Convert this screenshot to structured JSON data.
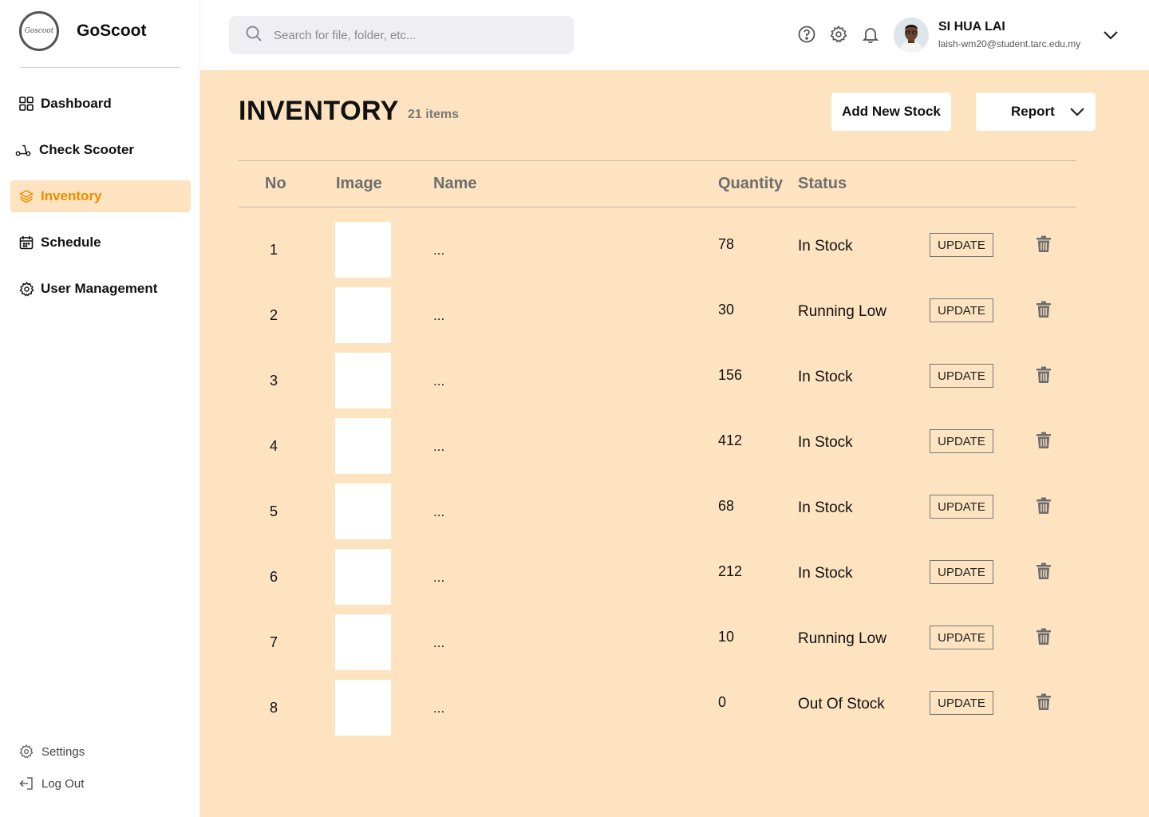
{
  "brand": {
    "logo_text": "Goscoot",
    "name": "GoScoot"
  },
  "nav": [
    {
      "label": "Dashboard",
      "icon": "grid-icon"
    },
    {
      "label": "Check Scooter",
      "icon": "scooter-icon"
    },
    {
      "label": "Inventory",
      "icon": "layers-icon",
      "active": true
    },
    {
      "label": "Schedule",
      "icon": "calendar-icon"
    },
    {
      "label": "User Management",
      "icon": "gear-icon"
    }
  ],
  "side_bottom": {
    "settings": "Settings",
    "logout": "Log Out"
  },
  "search": {
    "placeholder": "Search for file, folder, etc..."
  },
  "header_icons": [
    "help-icon",
    "gear-icon",
    "bell-icon"
  ],
  "user": {
    "name": "SI HUA LAI",
    "email": "laish-wm20@student.tarc.edu.my"
  },
  "page": {
    "title": "INVENTORY",
    "count": "21 items",
    "add_label": "Add New Stock",
    "report_label": "Report"
  },
  "table": {
    "headers": {
      "no": "No",
      "image": "Image",
      "name": "Name",
      "quantity": "Quantity",
      "status": "Status"
    },
    "update_label": "UPDATE",
    "rows": [
      {
        "no": "1",
        "name": "...",
        "quantity": "78",
        "status": "In Stock"
      },
      {
        "no": "2",
        "name": "...",
        "quantity": "30",
        "status": "Running Low"
      },
      {
        "no": "3",
        "name": "...",
        "quantity": "156",
        "status": "In Stock"
      },
      {
        "no": "4",
        "name": "...",
        "quantity": "412",
        "status": "In Stock"
      },
      {
        "no": "5",
        "name": "...",
        "quantity": "68",
        "status": "In Stock"
      },
      {
        "no": "6",
        "name": "...",
        "quantity": "212",
        "status": "In Stock"
      },
      {
        "no": "7",
        "name": "...",
        "quantity": "10",
        "status": "Running Low"
      },
      {
        "no": "8",
        "name": "...",
        "quantity": "0",
        "status": "Out Of Stock"
      }
    ]
  },
  "colors": {
    "accent": "#f08c00",
    "main_bg": "#fde3c0",
    "active_bg": "#fde3c0"
  }
}
